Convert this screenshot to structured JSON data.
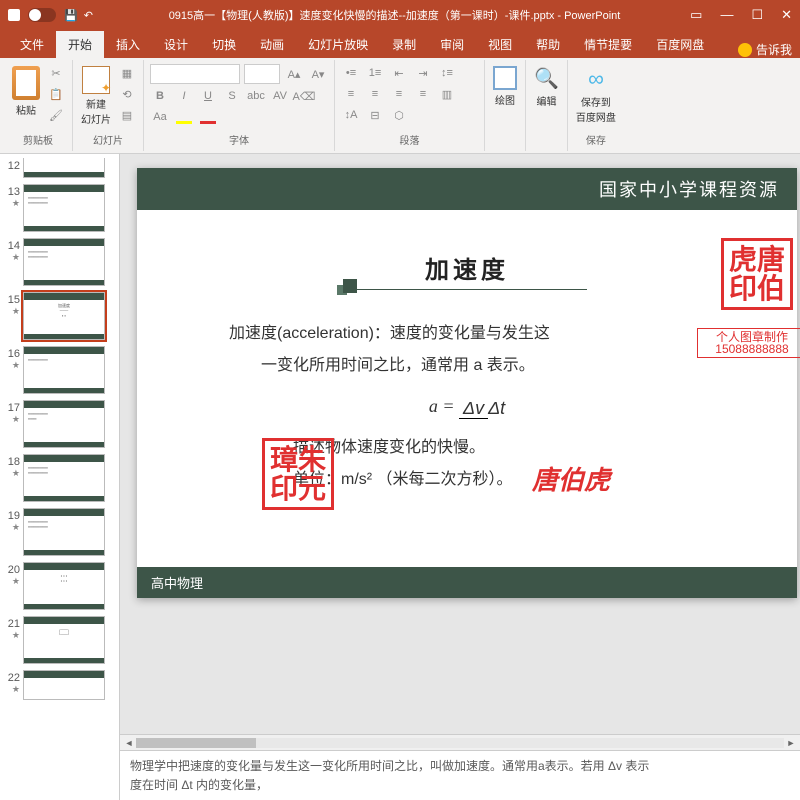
{
  "title": "0915高一【物理(人教版)】速度变化快慢的描述--加速度（第一课时）-课件.pptx - PowerPoint",
  "tabs": {
    "file": "文件",
    "home": "开始",
    "insert": "插入",
    "design": "设计",
    "transitions": "切换",
    "animations": "动画",
    "slideshow": "幻灯片放映",
    "record": "录制",
    "review": "审阅",
    "view": "视图",
    "help": "帮助",
    "qingjie": "情节提要",
    "baidu": "百度网盘",
    "tellme": "告诉我"
  },
  "groups": {
    "clipboard": "剪贴板",
    "slides": "幻灯片",
    "font": "字体",
    "paragraph": "段落",
    "drawing": "绘图",
    "editing": "编辑",
    "save": "保存"
  },
  "btns": {
    "paste": "粘贴",
    "newslide": "新建\n幻灯片",
    "draw": "绘图",
    "edit": "编辑",
    "savecloud": "保存到\n百度网盘"
  },
  "thumbs": [
    "12",
    "13",
    "14",
    "15",
    "16",
    "17",
    "18",
    "19",
    "20",
    "21",
    "22"
  ],
  "slide": {
    "header": "国家中小学课程资源",
    "title": "加速度",
    "line1": "加速度(acceleration)：速度的变化量与发生这",
    "line2": "一变化所用时间之比，通常用 a 表示。",
    "line3": "描述物体速度变化的快慢。",
    "line4": "单位：m/s²  （米每二次方秒）。",
    "footer": "高中物理"
  },
  "stamps": {
    "s1a": "虎唐",
    "s1b": "印伯",
    "s2": "个人图章制作",
    "s2b": "15088888888",
    "s3a": "璋朱",
    "s3b": "印元",
    "s4": "唐伯虎"
  },
  "notes": "      物理学中把速度的变化量与发生这一变化所用时间之比，叫做加速度。通常用a表示。若用 Δv 表示\n度在时间 Δt 内的变化量，"
}
